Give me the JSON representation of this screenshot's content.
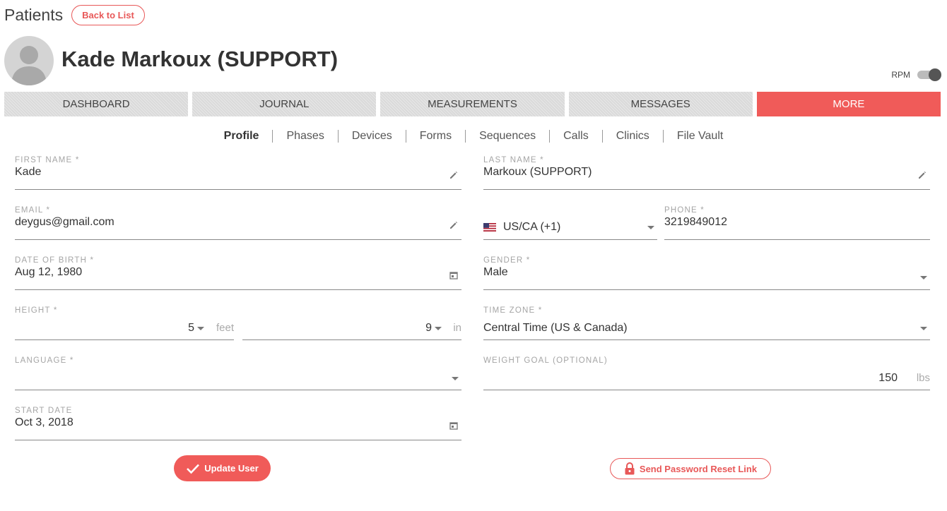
{
  "header": {
    "title": "Patients",
    "back_label": "Back to List"
  },
  "patient": {
    "name": "Kade Markoux (SUPPORT)"
  },
  "rpm": {
    "label": "RPM",
    "enabled": true
  },
  "tabs": [
    {
      "label": "DASHBOARD",
      "active": false
    },
    {
      "label": "JOURNAL",
      "active": false
    },
    {
      "label": "MEASUREMENTS",
      "active": false
    },
    {
      "label": "MESSAGES",
      "active": false
    },
    {
      "label": "MORE",
      "active": true
    }
  ],
  "subnav": [
    {
      "label": "Profile",
      "active": true
    },
    {
      "label": "Phases"
    },
    {
      "label": "Devices"
    },
    {
      "label": "Forms"
    },
    {
      "label": "Sequences"
    },
    {
      "label": "Calls"
    },
    {
      "label": "Clinics"
    },
    {
      "label": "File Vault"
    }
  ],
  "form": {
    "first_name": {
      "label": "FIRST NAME *",
      "value": "Kade",
      "icon": "pencil-icon"
    },
    "last_name": {
      "label": "LAST NAME *",
      "value": "Markoux (SUPPORT)",
      "icon": "pencil-icon"
    },
    "email": {
      "label": "EMAIL *",
      "value": "deygus@gmail.com",
      "icon": "pencil-icon"
    },
    "country_code": {
      "value": "US/CA (+1)",
      "icon": "us-flag-icon"
    },
    "phone": {
      "label": "PHONE *",
      "value": "3219849012"
    },
    "dob": {
      "label": "DATE OF BIRTH *",
      "value": "Aug 12, 1980",
      "icon": "calendar-icon"
    },
    "gender": {
      "label": "GENDER *",
      "value": "Male"
    },
    "height": {
      "label": "HEIGHT *",
      "feet": "5",
      "feet_unit": "feet",
      "inches": "9",
      "inches_unit": "in"
    },
    "timezone": {
      "label": "TIME ZONE *",
      "value": "Central Time (US & Canada)"
    },
    "language": {
      "label": "LANGUAGE *",
      "value": ""
    },
    "weight_goal": {
      "label": "WEIGHT GOAL (OPTIONAL)",
      "value": "150",
      "unit": "lbs"
    },
    "start_date": {
      "label": "START DATE",
      "value": "Oct 3, 2018",
      "icon": "calendar-icon"
    }
  },
  "actions": {
    "update_label": "Update User",
    "reset_label": "Send Password Reset Link"
  },
  "colors": {
    "accent": "#f05b59",
    "tab_bg": "#dadada",
    "label": "#a5a5a5"
  }
}
